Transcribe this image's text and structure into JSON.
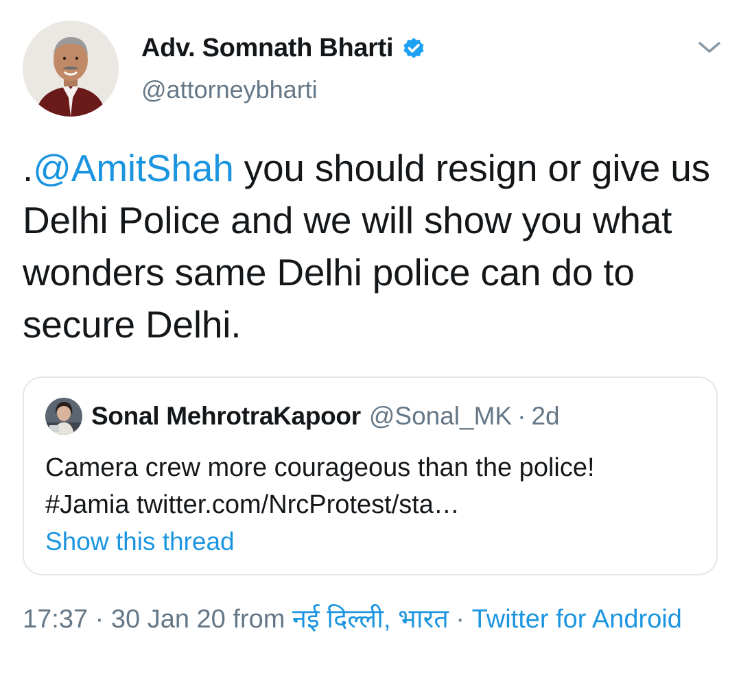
{
  "author": {
    "name": "Adv. Somnath Bharti",
    "handle": "@attorneybharti",
    "verified": true
  },
  "tweet": {
    "prefix": ".",
    "mention": "@AmitShah",
    "text": " you should resign or give us Delhi Police and we will show you what wonders same Delhi police can do to secure Delhi."
  },
  "quoted_tweet": {
    "name": "Sonal MehrotraKapoor",
    "handle": "@Sonal_MK",
    "separator": "·",
    "time": "2d",
    "text_line1": "Camera crew more courageous than the police!",
    "text_line2": "#Jamia twitter.com/NrcProtest/sta…",
    "show_thread": "Show this thread"
  },
  "meta": {
    "time": "17:37",
    "sep1": " · ",
    "date": "30 Jan 20",
    "from": " from ",
    "location": "नई दिल्ली, भारत",
    "sep2": " · ",
    "source": "Twitter for Android"
  },
  "colors": {
    "link": "#1b95e0",
    "secondary_text": "#657786",
    "primary_text": "#14171a",
    "border": "#e1e8ed",
    "verified": "#1da1f2"
  },
  "icons": {
    "verified": "verified-badge-icon",
    "caret": "chevron-down-icon"
  }
}
